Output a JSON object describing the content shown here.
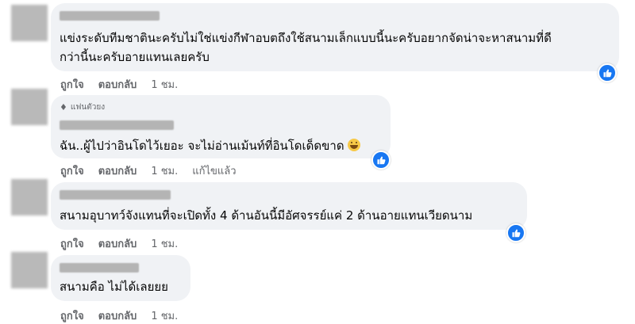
{
  "comments": [
    {
      "lines": [
        "แข่งระดับทีมชาตินะครับไม่ใช่แข่งกีฬาอบตถึงใช้สนามเล็กแบบนี้นะครับอยากจัดน่าจะหาสนามที่ดี",
        "กว่านี้นะครับอายแทนเลยครับ"
      ],
      "actions": [
        "ถูกใจ",
        "ตอบกลับ",
        "1 ชม."
      ]
    },
    {
      "badge": "แฟนตัวยง",
      "lines": [
        "ฉัน..ผู้ไปว่าอินโดไว้เยอะ จะไม่อ่านเม้นท์ที่อินโดเด็ดขาด"
      ],
      "actions": [
        "ถูกใจ",
        "ตอบกลับ",
        "1 ชม.",
        "แก้ไขแล้ว"
      ]
    },
    {
      "lines": [
        "สนามอุบาทว์จังแทนที่จะเปิดทั้ง 4 ด้านอันนี้มีอัศจรรย์แค่ 2 ด้านอายแทนเวียดนาม"
      ],
      "actions": [
        "ถูกใจ",
        "ตอบกลับ",
        "1 ชม."
      ]
    },
    {
      "lines": [
        "สนามคือ ไม่ได้เลยยย"
      ],
      "actions": [
        "ถูกใจ",
        "ตอบกลับ",
        "1 ชม."
      ]
    }
  ],
  "icons": {
    "reaction": "like-thumbs-up-icon",
    "emoji": "grinning-face-icon",
    "badge": "diamond-icon"
  },
  "colors": {
    "bubble": "#f0f2f5",
    "meta_text": "#65676b",
    "like_blue": "#1877f2"
  }
}
